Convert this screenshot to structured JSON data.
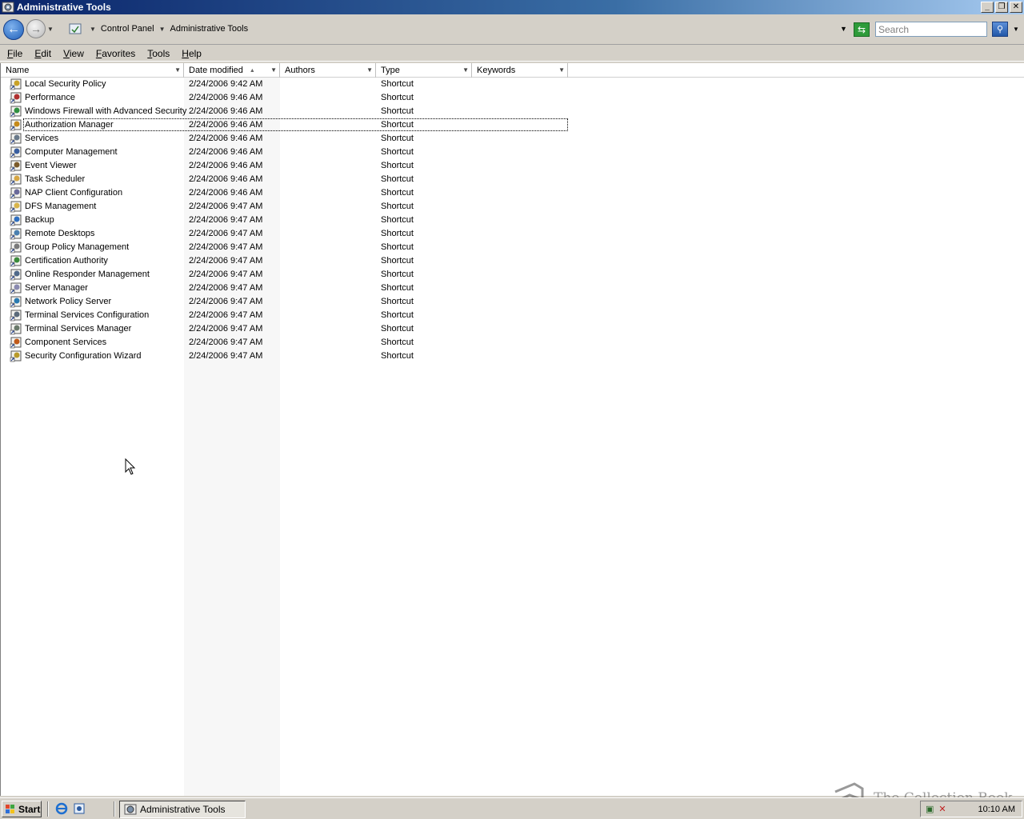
{
  "window": {
    "title": "Administrative Tools",
    "controls": {
      "minimize": "_",
      "restore": "❐",
      "close": "✕"
    }
  },
  "address": {
    "segments": [
      "Control Panel",
      "Administrative Tools"
    ],
    "search_placeholder": "Search"
  },
  "menu": [
    {
      "label": "File",
      "accel": "F",
      "rest": "ile"
    },
    {
      "label": "Edit",
      "accel": "E",
      "rest": "dit"
    },
    {
      "label": "View",
      "accel": "V",
      "rest": "iew"
    },
    {
      "label": "Favorites",
      "accel": "F",
      "rest": "avorites"
    },
    {
      "label": "Tools",
      "accel": "T",
      "rest": "ools"
    },
    {
      "label": "Help",
      "accel": "H",
      "rest": "elp"
    }
  ],
  "columns": {
    "name": "Name",
    "date": "Date modified",
    "authors": "Authors",
    "type": "Type",
    "keywords": "Keywords"
  },
  "items": [
    {
      "name": "Local Security Policy",
      "date": "2/24/2006 9:42 AM",
      "type": "Shortcut",
      "icon": "security-policy-icon"
    },
    {
      "name": "Performance",
      "date": "2/24/2006 9:46 AM",
      "type": "Shortcut",
      "icon": "performance-icon"
    },
    {
      "name": "Windows Firewall with Advanced Security",
      "date": "2/24/2006 9:46 AM",
      "type": "Shortcut",
      "icon": "firewall-icon"
    },
    {
      "name": "Authorization Manager",
      "date": "2/24/2006 9:46 AM",
      "type": "Shortcut",
      "icon": "authorization-icon"
    },
    {
      "name": "Services",
      "date": "2/24/2006 9:46 AM",
      "type": "Shortcut",
      "icon": "services-icon"
    },
    {
      "name": "Computer Management",
      "date": "2/24/2006 9:46 AM",
      "type": "Shortcut",
      "icon": "computer-management-icon"
    },
    {
      "name": "Event Viewer",
      "date": "2/24/2006 9:46 AM",
      "type": "Shortcut",
      "icon": "event-viewer-icon"
    },
    {
      "name": "Task Scheduler",
      "date": "2/24/2006 9:46 AM",
      "type": "Shortcut",
      "icon": "task-scheduler-icon"
    },
    {
      "name": "NAP Client Configuration",
      "date": "2/24/2006 9:46 AM",
      "type": "Shortcut",
      "icon": "nap-client-icon"
    },
    {
      "name": "DFS Management",
      "date": "2/24/2006 9:47 AM",
      "type": "Shortcut",
      "icon": "dfs-icon"
    },
    {
      "name": "Backup",
      "date": "2/24/2006 9:47 AM",
      "type": "Shortcut",
      "icon": "backup-icon"
    },
    {
      "name": "Remote Desktops",
      "date": "2/24/2006 9:47 AM",
      "type": "Shortcut",
      "icon": "remote-desktops-icon"
    },
    {
      "name": "Group Policy Management",
      "date": "2/24/2006 9:47 AM",
      "type": "Shortcut",
      "icon": "group-policy-icon"
    },
    {
      "name": "Certification Authority",
      "date": "2/24/2006 9:47 AM",
      "type": "Shortcut",
      "icon": "certificate-icon"
    },
    {
      "name": "Online Responder Management",
      "date": "2/24/2006 9:47 AM",
      "type": "Shortcut",
      "icon": "online-responder-icon"
    },
    {
      "name": "Server Manager",
      "date": "2/24/2006 9:47 AM",
      "type": "Shortcut",
      "icon": "server-manager-icon"
    },
    {
      "name": "Network Policy Server",
      "date": "2/24/2006 9:47 AM",
      "type": "Shortcut",
      "icon": "network-policy-icon"
    },
    {
      "name": "Terminal Services Configuration",
      "date": "2/24/2006 9:47 AM",
      "type": "Shortcut",
      "icon": "terminal-config-icon"
    },
    {
      "name": "Terminal Services Manager",
      "date": "2/24/2006 9:47 AM",
      "type": "Shortcut",
      "icon": "terminal-manager-icon"
    },
    {
      "name": "Component Services",
      "date": "2/24/2006 9:47 AM",
      "type": "Shortcut",
      "icon": "component-services-icon"
    },
    {
      "name": "Security Configuration Wizard",
      "date": "2/24/2006 9:47 AM",
      "type": "Shortcut",
      "icon": "security-wizard-icon"
    }
  ],
  "focused_index": 3,
  "taskbar": {
    "start_label": "Start",
    "task_label": "Administrative Tools",
    "clock": "10:10 AM"
  },
  "watermark": "The Collection Book"
}
